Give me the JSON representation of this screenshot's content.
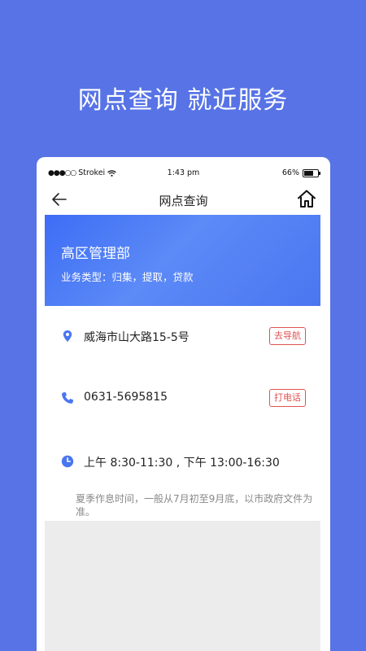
{
  "promo": {
    "title": "网点查询  就近服务"
  },
  "status_bar": {
    "signal": "●●●○○",
    "carrier": "Strokei",
    "time": "1:43 pm",
    "battery_text": "66%",
    "battery_level": 0.66
  },
  "nav": {
    "title": "网点查询",
    "back_icon": "arrow-left-icon",
    "home_icon": "home-icon"
  },
  "branch": {
    "name": "高区管理部",
    "business_type": "业务类型：归集，提取，贷款"
  },
  "address": {
    "text": "威海市山大路15-5号",
    "action": "去导航",
    "icon": "location-pin-icon"
  },
  "phone": {
    "text": "0631-5695815",
    "action": "打电话",
    "icon": "phone-icon"
  },
  "hours": {
    "text": "上午 8:30-11:30 , 下午 13:00-16:30",
    "note": "夏季作息时间，一般从7月初至9月底，以市政府文件为准。",
    "icon": "clock-icon"
  },
  "colors": {
    "background": "#5773e6",
    "banner": "#4a76f0",
    "accent_red": "#e05151",
    "icon_blue": "#4a76f0"
  }
}
